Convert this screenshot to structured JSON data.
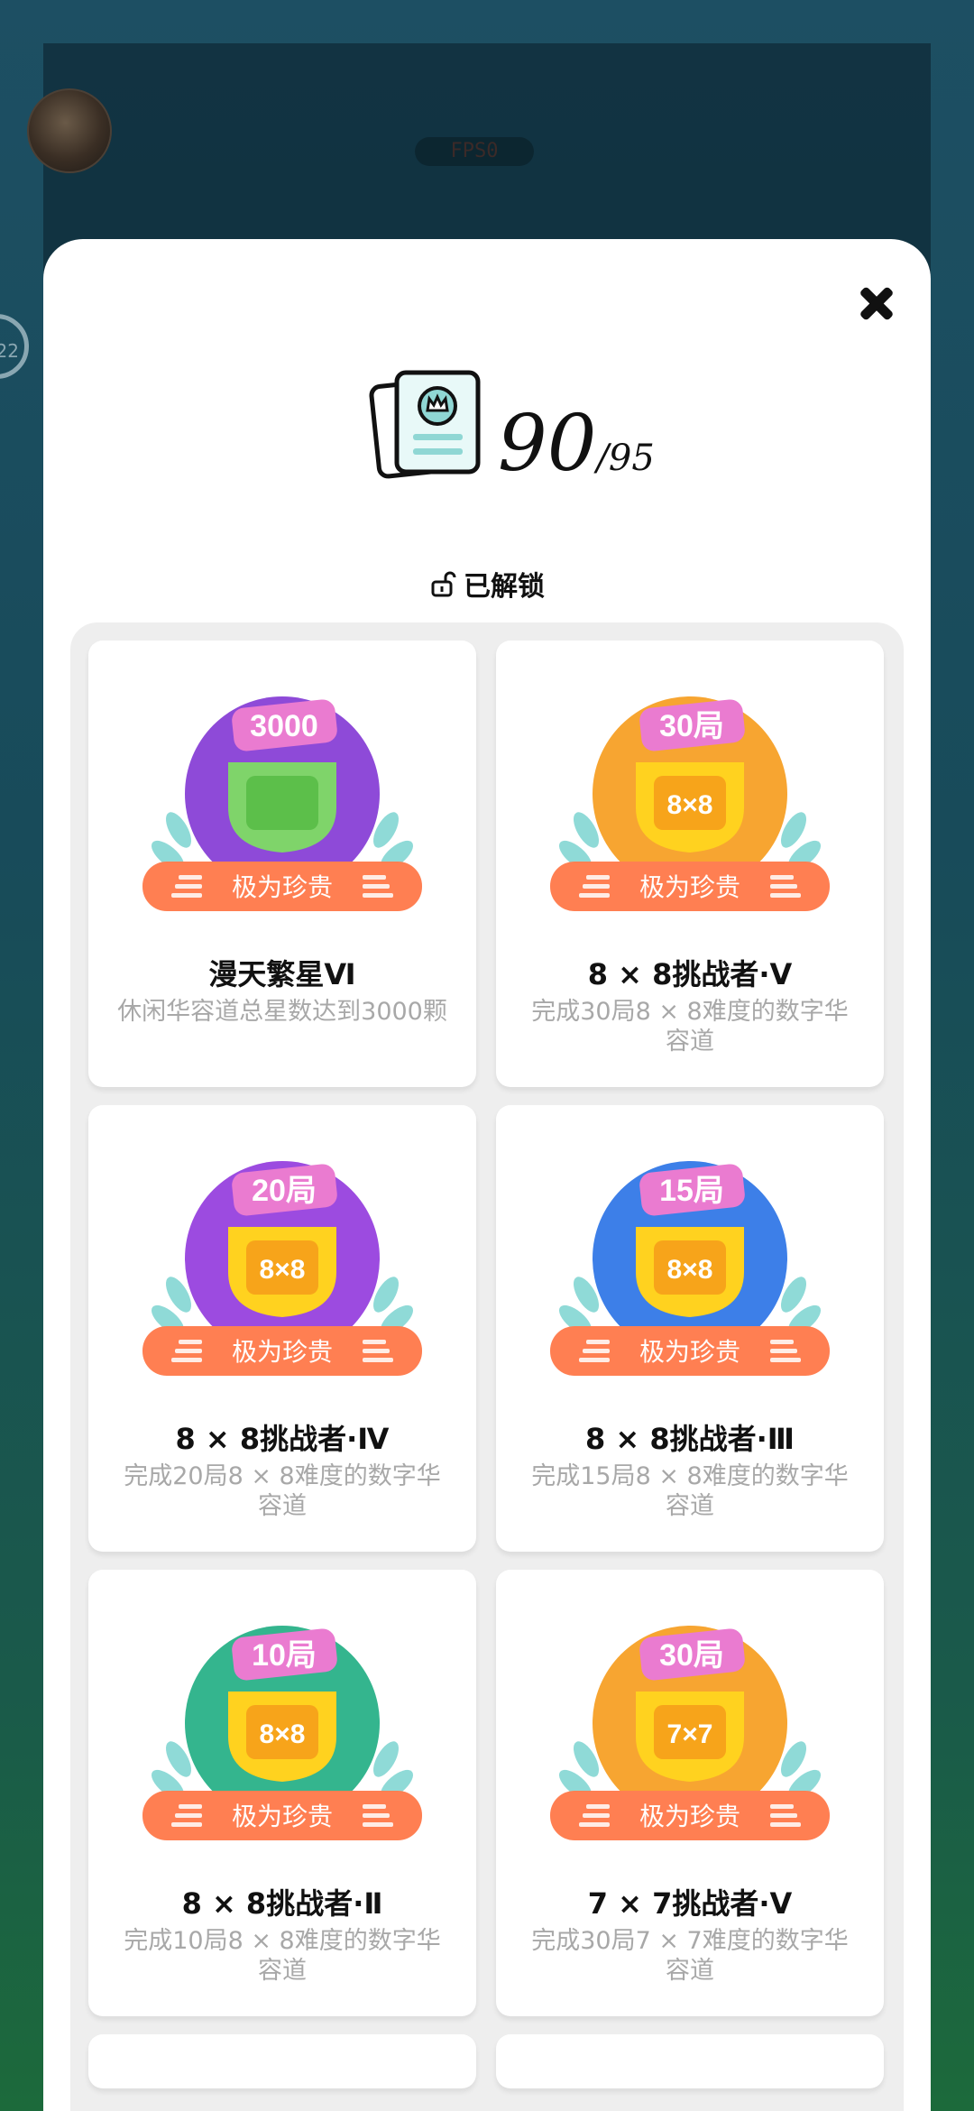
{
  "background": {
    "fps_label": "FPS0",
    "side_value": "22"
  },
  "modal": {
    "counter": {
      "unlocked": "90",
      "total": "/95"
    },
    "section_label": "已解锁",
    "achievements": [
      {
        "title": "漫天繁星Ⅵ",
        "desc": "休闲华容道总星数达到3000颗",
        "ribbon": "极为珍贵",
        "tag": "3000",
        "inner": "",
        "color": "#8e4ad8"
      },
      {
        "title": "8 × 8挑战者·Ⅴ",
        "desc": "完成30局8 × 8难度的数字华容道",
        "ribbon": "极为珍贵",
        "tag": "30局",
        "inner": "8×8",
        "color": "#f7a531"
      },
      {
        "title": "8 × 8挑战者·Ⅳ",
        "desc": "完成20局8 × 8难度的数字华容道",
        "ribbon": "极为珍贵",
        "tag": "20局",
        "inner": "8×8",
        "color": "#9c4be0"
      },
      {
        "title": "8 × 8挑战者·Ⅲ",
        "desc": "完成15局8 × 8难度的数字华容道",
        "ribbon": "极为珍贵",
        "tag": "15局",
        "inner": "8×8",
        "color": "#3d7fe8"
      },
      {
        "title": "8 × 8挑战者·Ⅱ",
        "desc": "完成10局8 × 8难度的数字华容道",
        "ribbon": "极为珍贵",
        "tag": "10局",
        "inner": "8×8",
        "color": "#34b58e"
      },
      {
        "title": "7 × 7挑战者·Ⅴ",
        "desc": "完成30局7 × 7难度的数字华容道",
        "ribbon": "极为珍贵",
        "tag": "30局",
        "inner": "7×7",
        "color": "#f7a531"
      }
    ]
  }
}
